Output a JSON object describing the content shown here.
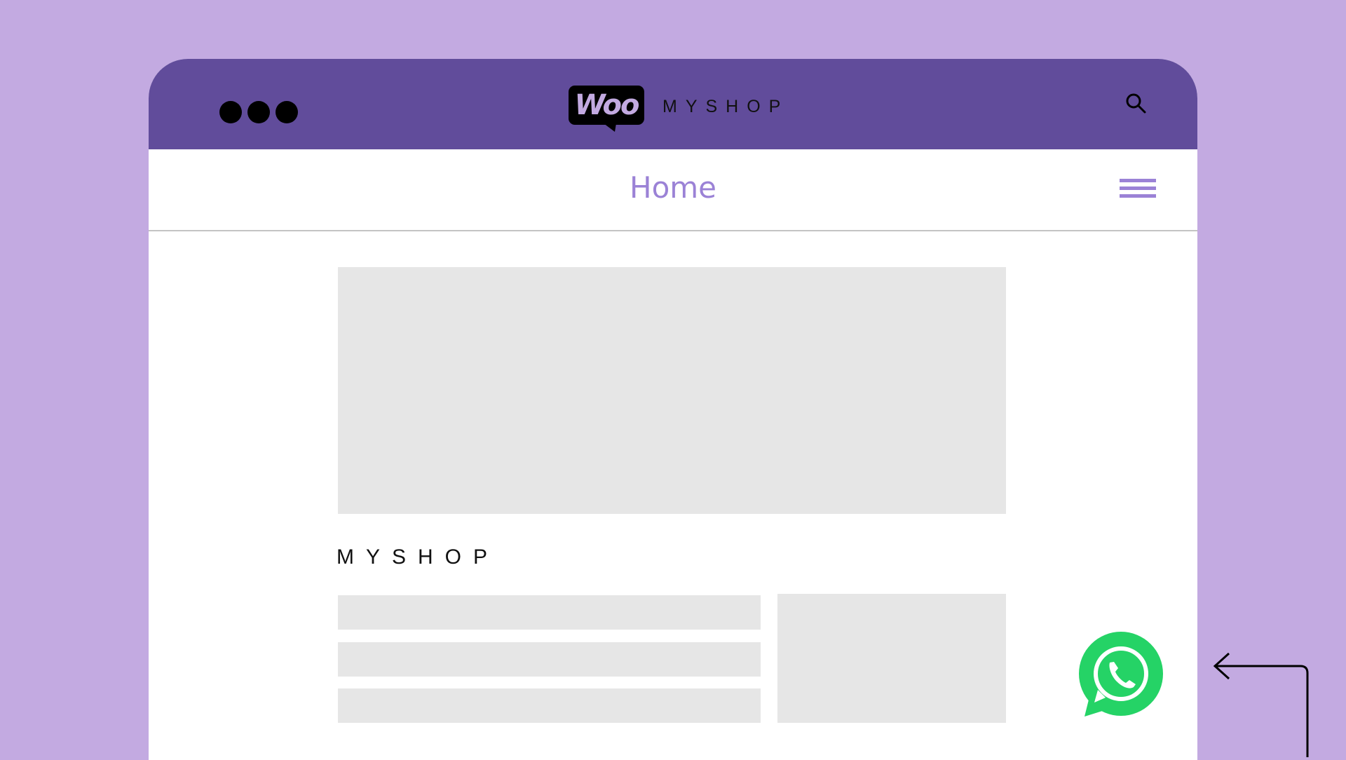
{
  "browser": {
    "logo": {
      "badge_text": "Woo",
      "brand_text": "MYSHOP"
    },
    "nav": {
      "title": "Home"
    },
    "content": {
      "heading": "MYSHOP"
    }
  },
  "colors": {
    "background": "#c3aae1",
    "topbar": "#614c9b",
    "accent": "#9b82d6",
    "placeholder": "#e6e6e6",
    "whatsapp": "#25d366"
  },
  "icons": {
    "window_controls": "three-dots-icon",
    "search": "search-icon",
    "menu": "hamburger-menu-icon",
    "whatsapp": "whatsapp-icon",
    "arrow": "arrow-left-icon"
  }
}
